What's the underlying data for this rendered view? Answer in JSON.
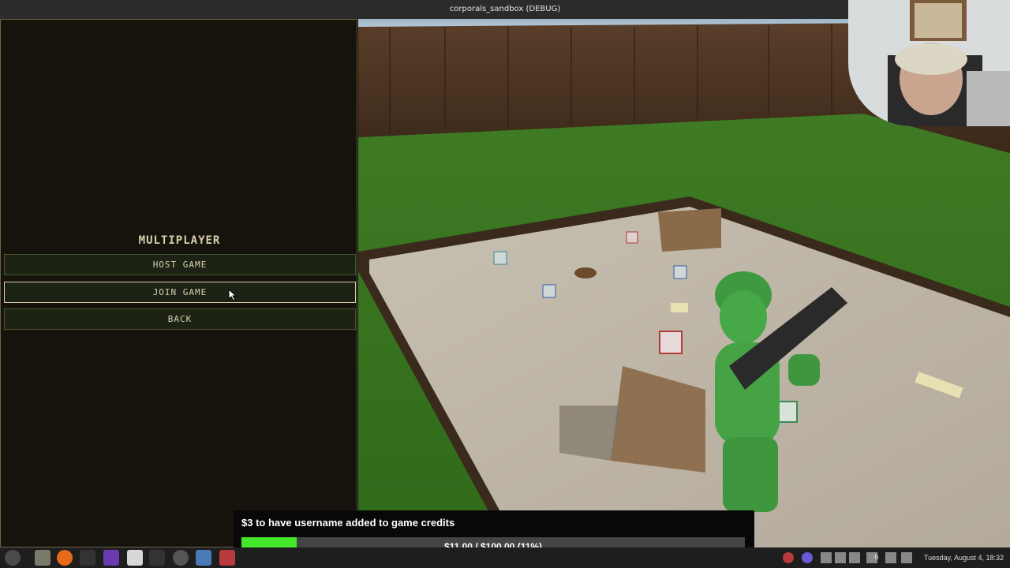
{
  "window": {
    "title": "corporals_sandbox (DEBUG)"
  },
  "menu": {
    "title": "MULTIPLAYER",
    "buttons": [
      {
        "label": "HOST GAME"
      },
      {
        "label": "JOIN GAME"
      },
      {
        "label": "BACK"
      }
    ]
  },
  "donation": {
    "message": "$3 to have username added to game credits",
    "progress_text": "$11.00 / $100.00 (11%)",
    "progress_fraction": 0.11,
    "fill_color": "#44e62a"
  },
  "taskbar": {
    "icons": [
      "menu-icon",
      "files-icon",
      "firefox-icon",
      "terminal-icon",
      "obsidian-icon",
      "text-editor-icon",
      "terminal2-icon",
      "obs-icon",
      "godot-icon",
      "app-icon"
    ],
    "tray_count": "6",
    "clock": "Tuesday, August  4, 18:32"
  }
}
